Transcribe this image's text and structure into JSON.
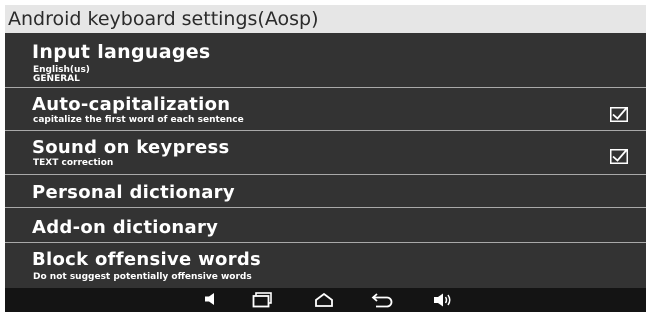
{
  "window": {
    "title": "Android keyboard settings(Aosp)"
  },
  "settings": {
    "input_languages": {
      "title": "Input languages",
      "sub1": "English(us)",
      "sub2": "GENERAL"
    },
    "auto_cap": {
      "title": "Auto-capitalization",
      "summary": "capitalize the first word of each sentence",
      "checked": true
    },
    "sound": {
      "title": "Sound on keypress",
      "summary": "TEXT correction",
      "checked": true
    },
    "personal_dict": {
      "title": "Personal dictionary"
    },
    "addon_dict": {
      "title": "Add-on dictionary"
    },
    "block_offensive": {
      "title": "Block offensive words",
      "summary": "Do not suggest potentially offensive words"
    }
  },
  "nav_bar": {
    "buttons": [
      "volume-down-icon",
      "recent-apps-icon",
      "home-icon",
      "back-icon",
      "volume-up-icon"
    ]
  },
  "colors": {
    "background": "#333333",
    "title_bar": "#e6e6e6",
    "text": "#ffffff",
    "divider": "#a9a9a9",
    "nav_bar": "#141414"
  }
}
